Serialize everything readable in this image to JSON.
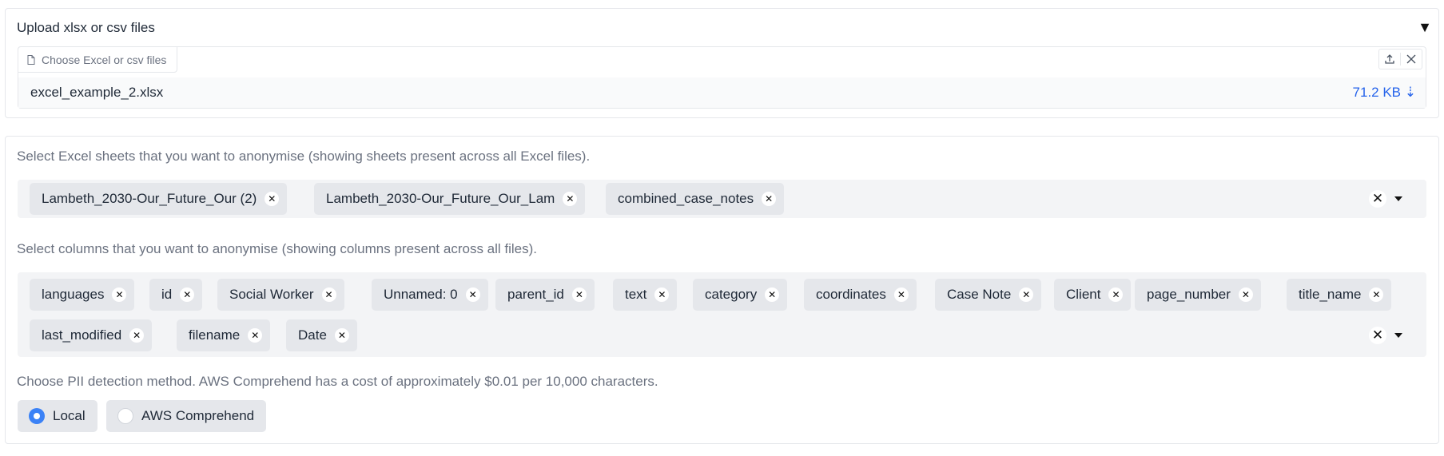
{
  "upload": {
    "title": "Upload xlsx or csv files",
    "collapse_icon": "triangle-down-icon",
    "choose_label": "Choose Excel or csv files",
    "file": {
      "name": "excel_example_2.xlsx",
      "size": "71.2 KB ⇣"
    }
  },
  "sheets": {
    "label": "Select Excel sheets that you want to anonymise (showing sheets present across all Excel files).",
    "tags": [
      "Lambeth_2030-Our_Future_Our (2)",
      "Lambeth_2030-Our_Future_Our_Lam",
      "combined_case_notes"
    ]
  },
  "columns": {
    "label": "Select columns that you want to anonymise (showing columns present across all files).",
    "tags_row1": [
      "languages",
      "id",
      "Social Worker",
      "Unnamed: 0",
      "parent_id",
      "text",
      "category",
      "coordinates",
      "Case Note",
      "Client",
      "page_number",
      "title_name"
    ],
    "tags_row2": [
      "last_modified",
      "filename",
      "Date"
    ]
  },
  "pii": {
    "label": "Choose PII detection method. AWS Comprehend has a cost of approximately $0.01 per 10,000 characters.",
    "options": [
      {
        "label": "Local",
        "selected": true
      },
      {
        "label": "AWS Comprehend",
        "selected": false
      }
    ]
  },
  "colors": {
    "accent": "#3b82f6",
    "link": "#2563eb",
    "tag_bg": "#e5e7eb",
    "box_bg": "#f3f4f6"
  }
}
